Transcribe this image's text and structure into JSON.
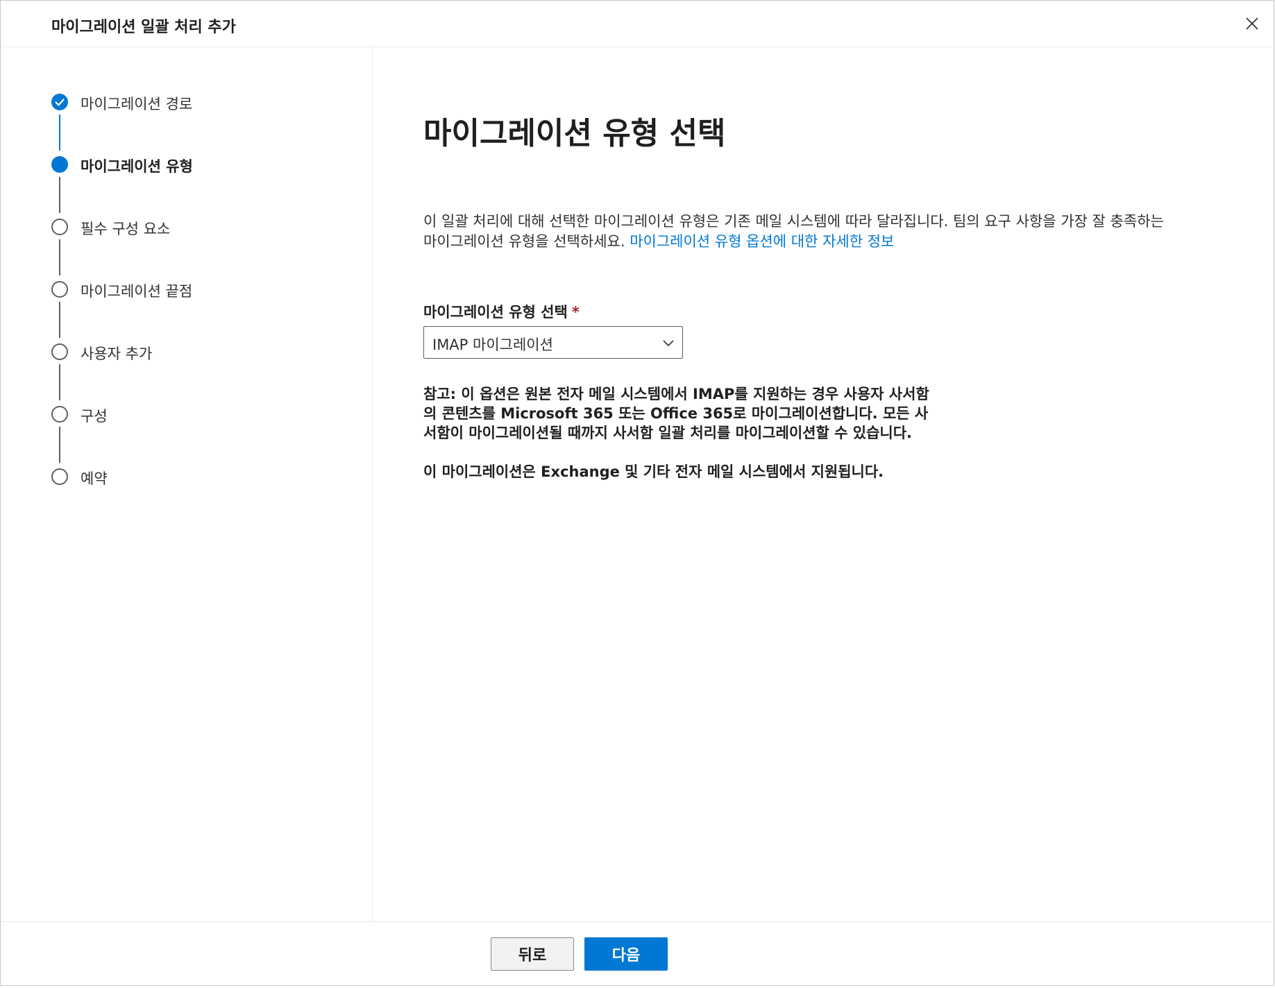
{
  "header": {
    "title": "마이그레이션 일괄 처리 추가"
  },
  "steps": [
    {
      "label": "마이그레이션 경로",
      "state": "done"
    },
    {
      "label": "마이그레이션 유형",
      "state": "current"
    },
    {
      "label": "필수 구성 요소",
      "state": "todo"
    },
    {
      "label": "마이그레이션 끝점",
      "state": "todo"
    },
    {
      "label": "사용자 추가",
      "state": "todo"
    },
    {
      "label": "구성",
      "state": "todo"
    },
    {
      "label": "예약",
      "state": "todo"
    }
  ],
  "main": {
    "title": "마이그레이션 유형 선택",
    "description": "이 일괄 처리에 대해 선택한 마이그레이션 유형은 기존 메일 시스템에 따라 달라집니다. 팀의 요구 사항을 가장 잘 충족하는 마이그레이션 유형을 선택하세요.",
    "link_text": "마이그레이션 유형 옵션에 대한 자세한 정보",
    "field_label": "마이그레이션 유형 선택",
    "required_mark": "*",
    "dropdown_value": "IMAP 마이그레이션",
    "note1": "참고: 이 옵션은 원본 전자 메일 시스템에서 IMAP를 지원하는 경우 사용자 사서함의 콘텐츠를 Microsoft 365 또는 Office 365로 마이그레이션합니다. 모든 사서함이 마이그레이션될 때까지 사서함 일괄 처리를 마이그레이션할 수 있습니다.",
    "note2": "이 마이그레이션은 Exchange 및 기타 전자 메일 시스템에서 지원됩니다."
  },
  "footer": {
    "back_label": "뒤로",
    "next_label": "다음"
  },
  "colors": {
    "accent": "#0078d4",
    "required": "#a4262c"
  },
  "icons": {
    "close": "close-icon",
    "chevron": "chevron-down-icon",
    "check": "checkmark-icon"
  }
}
